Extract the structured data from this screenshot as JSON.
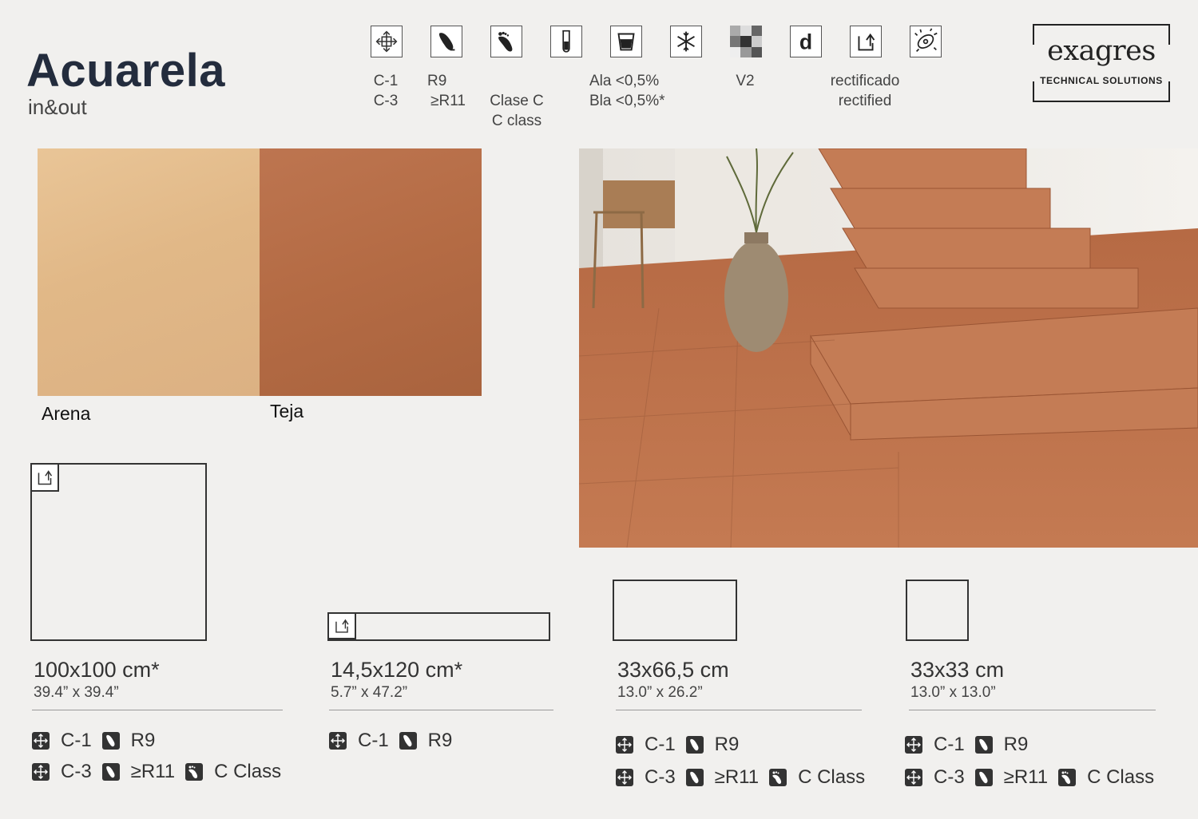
{
  "header": {
    "title": "Acuarela",
    "subtitle": "in&out"
  },
  "features": {
    "items": [
      {
        "icon": "stain-resistance-icon",
        "lines": [
          "C-1",
          "C-3"
        ]
      },
      {
        "icon": "slip-resistance-icon",
        "lines": [
          "R9",
          "≥R11"
        ]
      },
      {
        "icon": "barefoot-icon",
        "lines": [
          "Clase C",
          "C class"
        ]
      },
      {
        "icon": "chemical-resistance-icon",
        "lines": [
          "Ala <0,5%",
          "Bla <0,5%*"
        ]
      },
      {
        "icon": "water-absorption-icon",
        "lines": []
      },
      {
        "icon": "frost-resistance-icon",
        "lines": []
      },
      {
        "icon": "shade-variation-icon",
        "lines": [
          "V2"
        ]
      },
      {
        "icon": "thickness-d-icon",
        "lines": []
      },
      {
        "icon": "rectified-icon",
        "lines": [
          "rectificado",
          "rectified"
        ]
      },
      {
        "icon": "antibacterial-icon",
        "lines": []
      }
    ]
  },
  "logo": {
    "name": "exagres",
    "tagline": "TECHNICAL SOLUTIONS"
  },
  "colors": {
    "items": [
      {
        "name": "Arena",
        "hex": "#e3bb8c"
      },
      {
        "name": "Teja",
        "hex": "#b86e46"
      }
    ]
  },
  "formats": {
    "items": [
      {
        "size": "100x100 cm*",
        "inches": "39.4” x 39.4”",
        "rows": [
          [
            {
              "icon": "stain-resistance-icon",
              "text": "C-1"
            },
            {
              "icon": "slip-resistance-icon",
              "text": "R9"
            }
          ],
          [
            {
              "icon": "stain-resistance-icon",
              "text": "C-3"
            },
            {
              "icon": "slip-resistance-icon",
              "text": "≥R11"
            },
            {
              "icon": "barefoot-icon",
              "text": "C Class"
            }
          ]
        ]
      },
      {
        "size": "14,5x120 cm*",
        "inches": "5.7” x 47.2”",
        "rows": [
          [
            {
              "icon": "stain-resistance-icon",
              "text": "C-1"
            },
            {
              "icon": "slip-resistance-icon",
              "text": "R9"
            }
          ]
        ]
      },
      {
        "size": "33x66,5 cm",
        "inches": "13.0” x 26.2”",
        "rows": [
          [
            {
              "icon": "stain-resistance-icon",
              "text": "C-1"
            },
            {
              "icon": "slip-resistance-icon",
              "text": "R9"
            }
          ],
          [
            {
              "icon": "stain-resistance-icon",
              "text": "C-3"
            },
            {
              "icon": "slip-resistance-icon",
              "text": "≥R11"
            },
            {
              "icon": "barefoot-icon",
              "text": "C Class"
            }
          ]
        ]
      },
      {
        "size": "33x33 cm",
        "inches": "13.0” x 13.0”",
        "rows": [
          [
            {
              "icon": "stain-resistance-icon",
              "text": "C-1"
            },
            {
              "icon": "slip-resistance-icon",
              "text": "R9"
            }
          ],
          [
            {
              "icon": "stain-resistance-icon",
              "text": "C-3"
            },
            {
              "icon": "slip-resistance-icon",
              "text": "≥R11"
            },
            {
              "icon": "barefoot-icon",
              "text": "C Class"
            }
          ]
        ]
      }
    ]
  }
}
